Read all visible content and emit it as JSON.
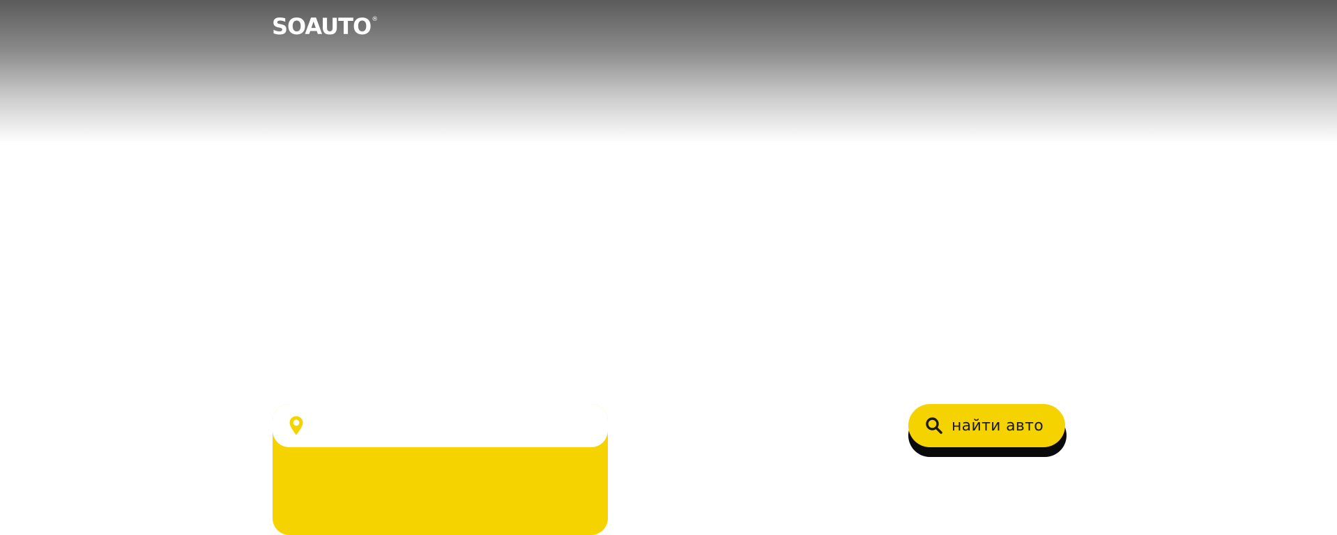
{
  "header": {
    "logo_text": "SOAUTO",
    "logo_mark": "®"
  },
  "search": {
    "location_icon": "location-pin-icon",
    "location_placeholder": "",
    "location_value": "",
    "button_label": "найти авто",
    "button_icon": "search-icon"
  },
  "colors": {
    "accent": "#f5d300",
    "button_shadow": "#0a0a0a",
    "header_gradient_top": "#5b5b5b",
    "background": "#ffffff"
  }
}
